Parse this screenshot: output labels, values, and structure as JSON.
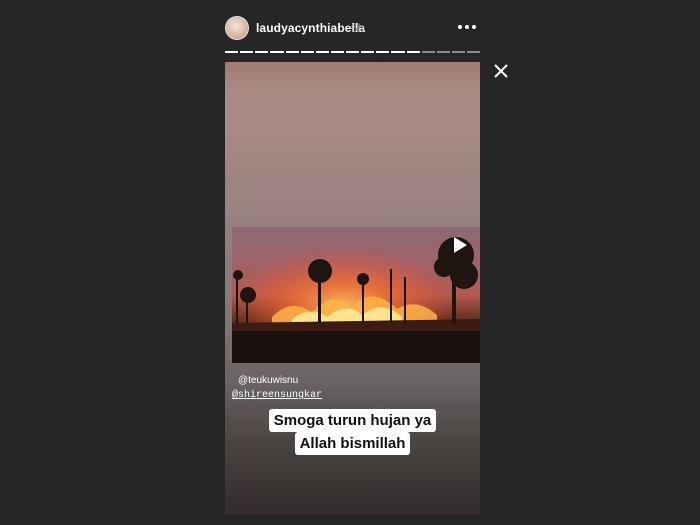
{
  "story": {
    "username": "laudyacynthiabella",
    "time": "6h",
    "progress_segments": {
      "total": 17,
      "completed": 13
    },
    "mentions": [
      "@teukuwisnu",
      "@shireensungkar"
    ],
    "caption_lines": [
      "Smoga turun hujan ya",
      "Allah bismillah"
    ]
  },
  "icons": {
    "more": "more-horizontal-icon",
    "close": "close-icon",
    "play": "play-icon"
  },
  "colors": {
    "background": "#262626",
    "text": "#ffffff",
    "muted": "#a8a8a8"
  }
}
